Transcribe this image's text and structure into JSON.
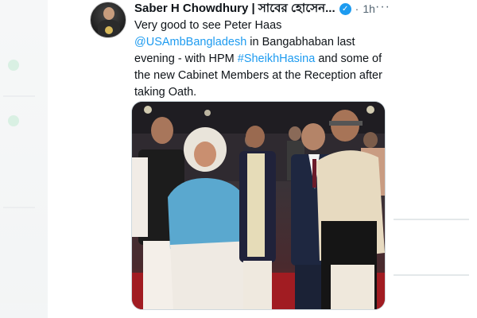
{
  "tweet": {
    "author_name": "Saber H Chowdhury | সাবের হোসেন...",
    "verified_glyph": "✓",
    "dot": "·",
    "time": "1h",
    "more_glyph": "···",
    "text_part1": "Very good to see Peter Haas ",
    "mention": "@USAmbBangladesh",
    "text_part2": " in Bangabhaban last evening - with HPM ",
    "hashtag": "#SheikhHasina",
    "text_part3": " and some of the new Cabinet Members at the Reception after taking Oath.",
    "photo_icon": "photo-image",
    "avatar_icon": "avatar-portrait"
  },
  "colors": {
    "link": "#1d9bf0",
    "verified": "#1d9bf0",
    "text": "#0f1419",
    "muted": "#536471"
  }
}
